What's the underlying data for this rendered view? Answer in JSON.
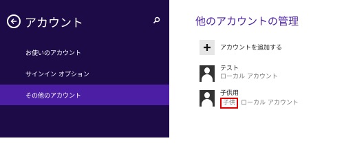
{
  "sidebar": {
    "title": "アカウント",
    "items": [
      {
        "label": "お使いのアカウント"
      },
      {
        "label": "サインイン オプション"
      },
      {
        "label": "その他のアカウント"
      }
    ]
  },
  "main": {
    "title": "他のアカウントの管理",
    "add_account_label": "アカウントを追加する",
    "accounts": [
      {
        "name": "テスト",
        "type": "ローカル アカウント"
      },
      {
        "name": "子供用",
        "tag": "子供",
        "type": "ローカル アカウント"
      }
    ]
  },
  "colors": {
    "sidebar_bg": "#1c0b47",
    "sidebar_active": "#4b1ea3",
    "accent_title": "#4b1ea3",
    "highlight": "#e00000"
  }
}
